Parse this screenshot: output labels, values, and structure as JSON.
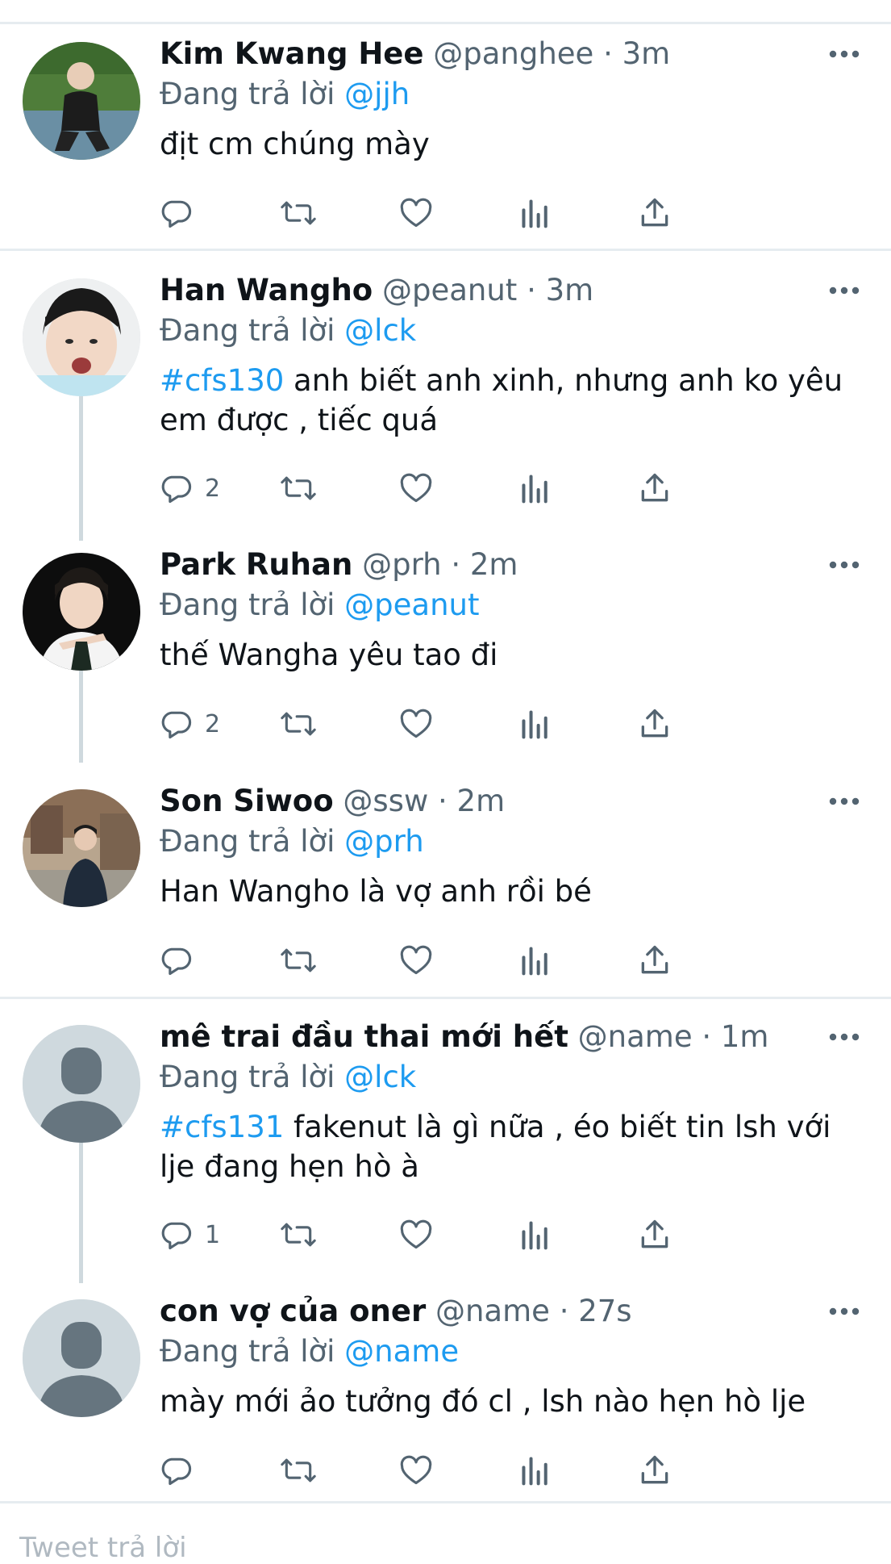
{
  "reply_prefix": "Đang trả lời",
  "tweets": [
    {
      "name": "Kim Kwang Hee",
      "handle": "@panghee",
      "dot": "·",
      "time": "3m",
      "reply_to": "@jjh",
      "hashtag": "",
      "text": "địt cm chúng mày",
      "reply_count": ""
    },
    {
      "name": "Han Wangho",
      "handle": "@peanut",
      "dot": "·",
      "time": "3m",
      "reply_to": "@lck",
      "hashtag": "#cfs130",
      "text": " anh biết anh xinh, nhưng anh ko yêu em được , tiếc quá",
      "reply_count": "2"
    },
    {
      "name": "Park Ruhan",
      "handle": "@prh",
      "dot": "·",
      "time": "2m",
      "reply_to": "@peanut",
      "hashtag": "",
      "text": "thế Wangha yêu tao đi",
      "reply_count": "2"
    },
    {
      "name": "Son Siwoo",
      "handle": "@ssw",
      "dot": "·",
      "time": "2m",
      "reply_to": "@prh",
      "hashtag": "",
      "text": "Han Wangho là vợ anh rồi bé",
      "reply_count": ""
    },
    {
      "name": "mê trai đầu thai mới hết",
      "handle": "@name",
      "dot": "·",
      "time": "1m",
      "reply_to": "@lck",
      "hashtag": "#cfs131",
      "text": " fakenut là gì nữa , éo biết tin lsh với lje đang hẹn hò à",
      "reply_count": "1"
    },
    {
      "name": "con vợ của oner",
      "handle": "@name",
      "dot": "·",
      "time": "27s",
      "reply_to": "@name",
      "hashtag": "",
      "text": "mày mới ảo tưởng đó cl , lsh nào hẹn hò lje",
      "reply_count": ""
    }
  ],
  "icons": {
    "reply": "reply-icon",
    "retweet": "retweet-icon",
    "like": "heart-icon",
    "analytics": "analytics-icon",
    "share": "share-icon",
    "more": "more-icon"
  },
  "colors": {
    "accent": "#1d9bf0",
    "secondary_text": "#536471",
    "icon": "#536471",
    "divider": "#e6ecf0",
    "default_avatar_bg": "#cfd9de"
  },
  "compose_placeholder": "Tweet trả lời"
}
